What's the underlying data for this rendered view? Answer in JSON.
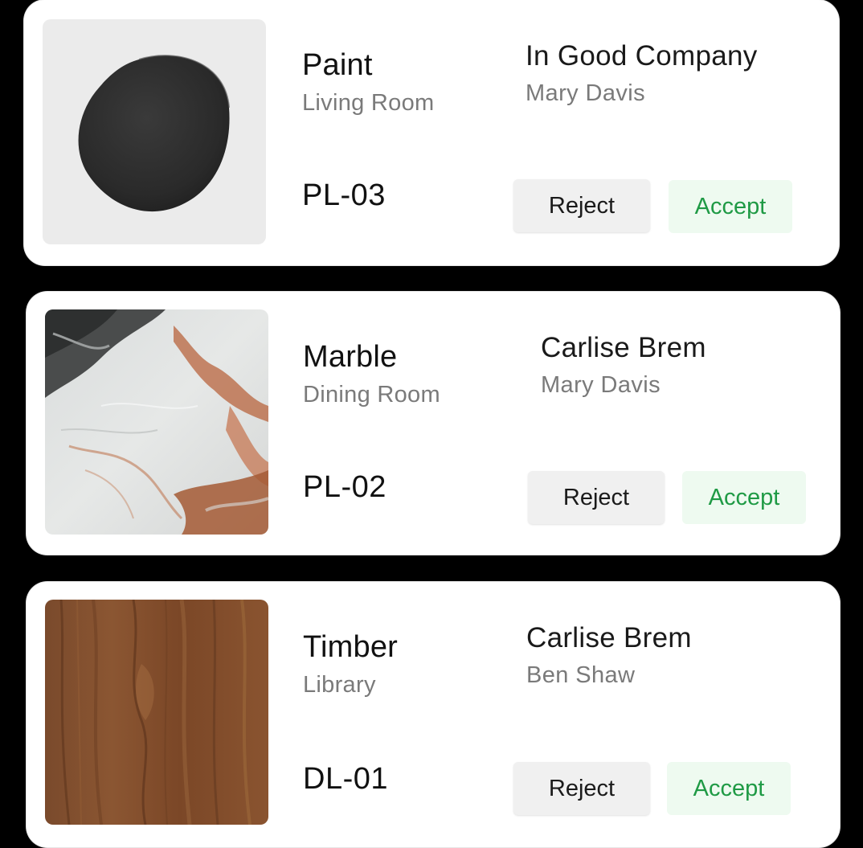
{
  "cards": [
    {
      "material": "Paint",
      "room": "Living Room",
      "code": "PL-03",
      "supplier": "In Good Company",
      "person": "Mary Davis",
      "reject_label": "Reject",
      "accept_label": "Accept",
      "swatch": "paint-swatch"
    },
    {
      "material": "Marble",
      "room": "Dining Room",
      "code": "PL-02",
      "supplier": "Carlise Brem",
      "person": "Mary Davis",
      "reject_label": "Reject",
      "accept_label": "Accept",
      "swatch": "marble-swatch"
    },
    {
      "material": "Timber",
      "room": "Library",
      "code": "DL-01",
      "supplier": "Carlise Brem",
      "person": "Ben Shaw",
      "reject_label": "Reject",
      "accept_label": "Accept",
      "swatch": "timber-swatch"
    }
  ],
  "colors": {
    "accept_text": "#1f9a45",
    "accept_bg": "#eefaf0",
    "reject_bg": "#f0f0f0",
    "secondary_text": "#7a7a7a"
  }
}
